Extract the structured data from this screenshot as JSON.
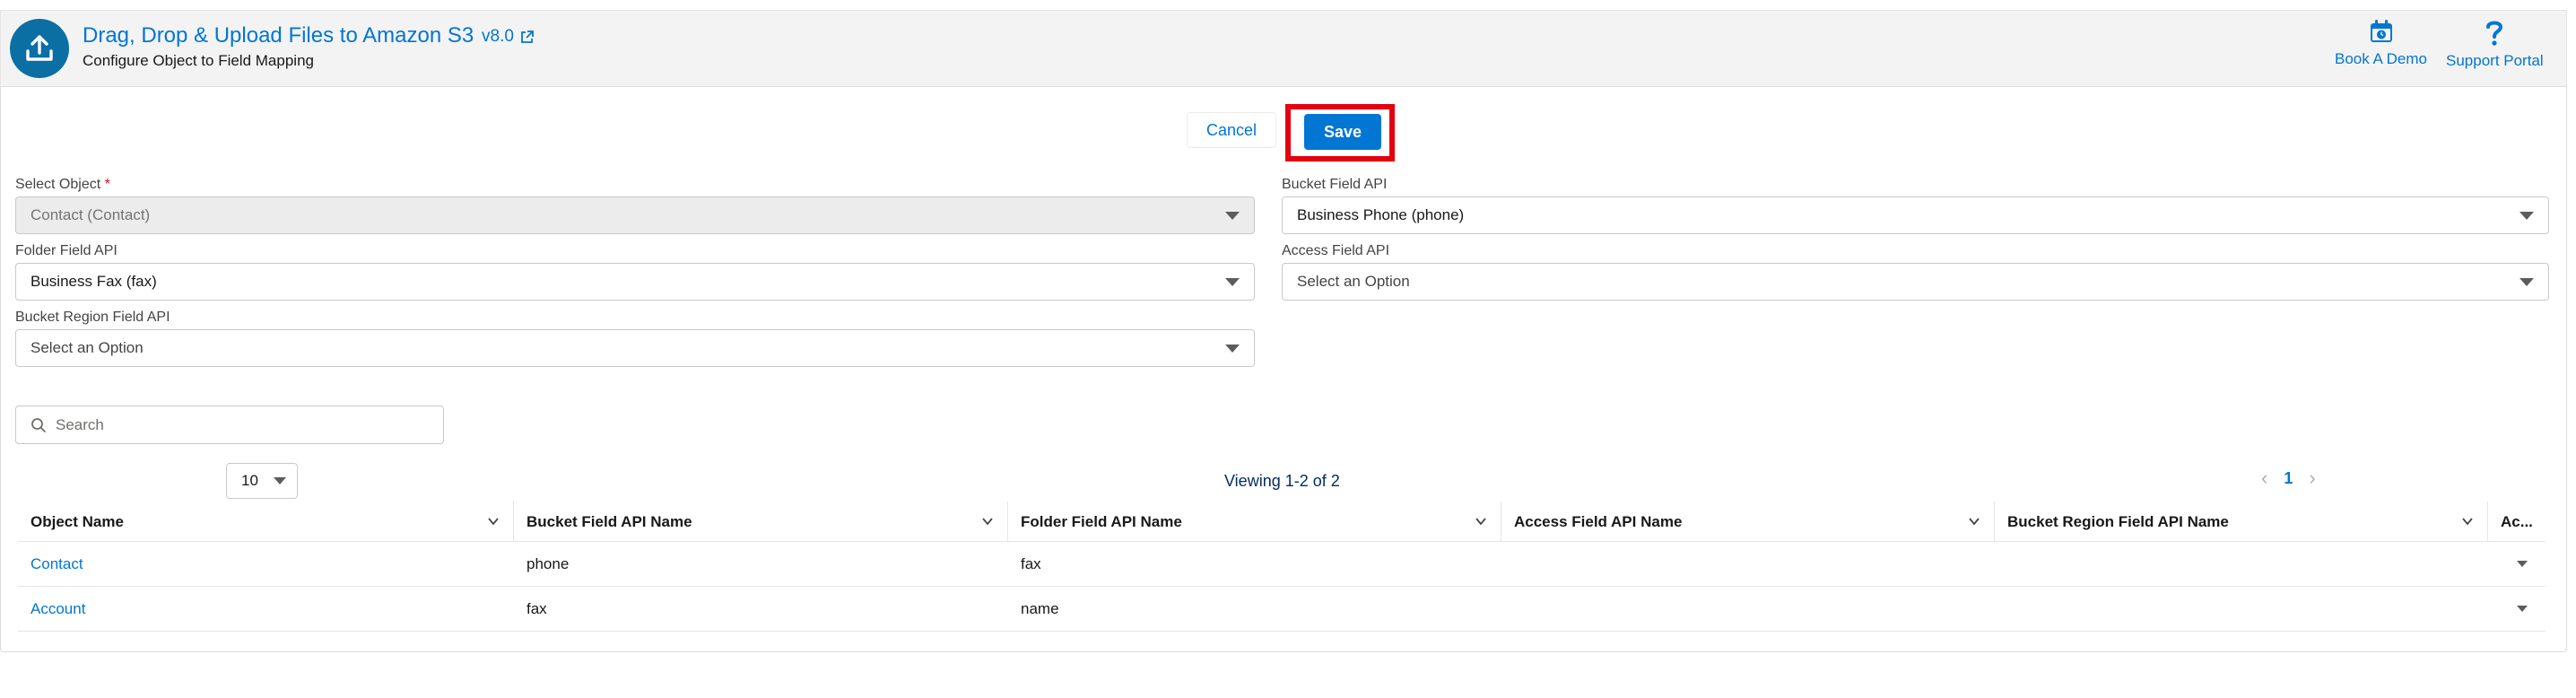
{
  "app": {
    "title": "Drag, Drop & Upload Files to Amazon S3",
    "version": "v8.0",
    "subtitle": "Configure Object to Field Mapping",
    "icon": "upload-icon"
  },
  "header_actions": [
    {
      "label": "Book A Demo",
      "icon": "calendar-icon"
    },
    {
      "label": "Support Portal",
      "icon": "question-icon"
    }
  ],
  "buttons": {
    "cancel": "Cancel",
    "save": "Save"
  },
  "form": {
    "select_object": {
      "label": "Select Object",
      "required_mark": "*",
      "value": "Contact (Contact)"
    },
    "bucket_field": {
      "label": "Bucket Field API",
      "value": "Business Phone (phone)"
    },
    "folder_field": {
      "label": "Folder Field API",
      "value": "Business Fax (fax)"
    },
    "access_field": {
      "label": "Access Field API",
      "value": "Select an Option"
    },
    "bucket_region_field": {
      "label": "Bucket Region Field API",
      "value": "Select an Option"
    }
  },
  "search": {
    "placeholder": "Search",
    "value": ""
  },
  "pagination": {
    "page_size": "10",
    "viewing": "Viewing 1-2 of 2",
    "current_page": "1"
  },
  "table": {
    "columns": [
      "Object Name",
      "Bucket Field API Name",
      "Folder Field API Name",
      "Access Field API Name",
      "Bucket Region Field API Name",
      "Ac..."
    ],
    "rows": [
      [
        "Contact",
        "phone",
        "fax",
        "",
        ""
      ],
      [
        "Account",
        "fax",
        "name",
        "",
        ""
      ]
    ]
  },
  "colors": {
    "brand": "#0176d3",
    "highlight": "#e3000f",
    "header_bg": "#f3f3f3"
  }
}
